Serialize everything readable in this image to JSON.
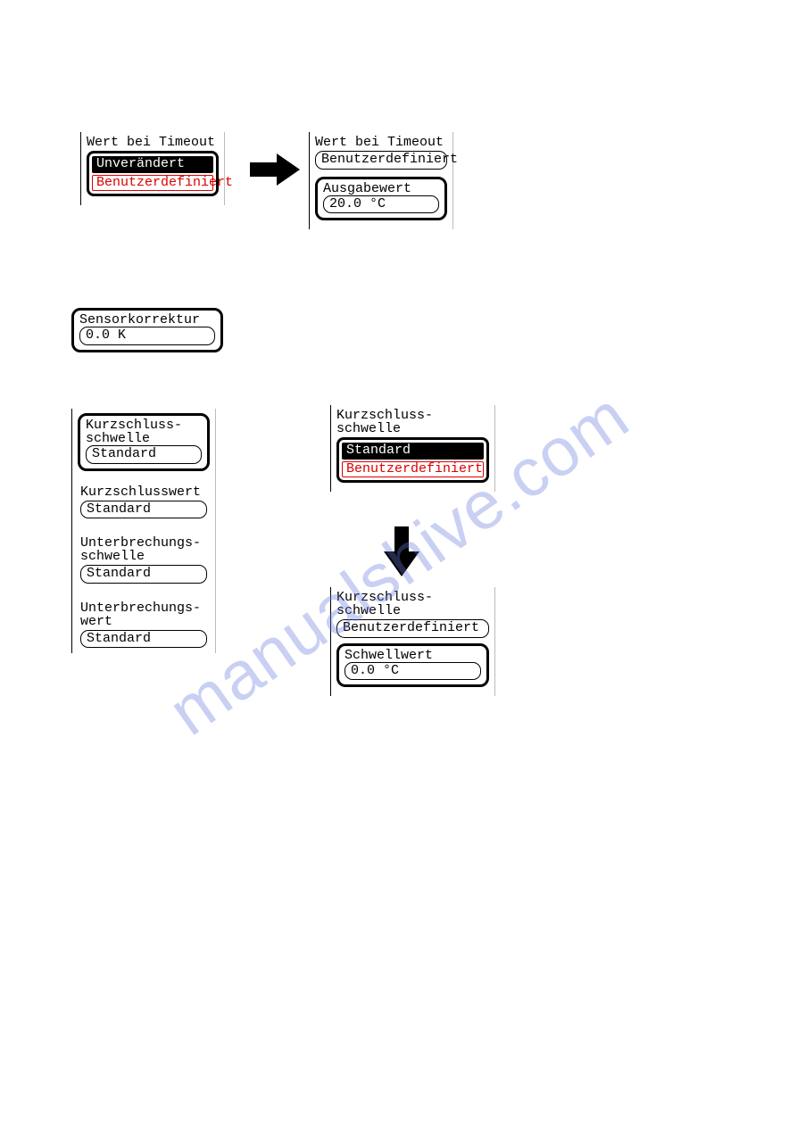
{
  "watermark": "manualshive.com",
  "timeout_menu": {
    "title": "Wert bei Timeout",
    "option_selected": "Unverändert",
    "option_other": "Benutzerdefiniert"
  },
  "timeout_result": {
    "title": "Wert bei Timeout",
    "value": "Benutzerdefiniert",
    "output_label": "Ausgabewert",
    "output_value": "20.0 °C"
  },
  "sensor": {
    "label": "Sensorkorrektur",
    "value": "0.0 K"
  },
  "left_col": {
    "kurz_schwelle": {
      "label": "Kurzschluss-\nschwelle",
      "value": "Standard"
    },
    "kurz_wert": {
      "label": "Kurzschlusswert",
      "value": "Standard"
    },
    "unter_schwelle": {
      "label": "Unterbrechungs-\nschwelle",
      "value": "Standard"
    },
    "unter_wert": {
      "label": "Unterbrechungs-\nwert",
      "value": "Standard"
    }
  },
  "kurz_menu": {
    "title": "Kurzschluss-\nschwelle",
    "option_selected": "Standard",
    "option_other": "Benutzerdefiniert"
  },
  "kurz_result": {
    "title": "Kurzschluss-\nschwelle",
    "value": "Benutzerdefiniert",
    "threshold_label": "Schwellwert",
    "threshold_value": "0.0 °C"
  }
}
